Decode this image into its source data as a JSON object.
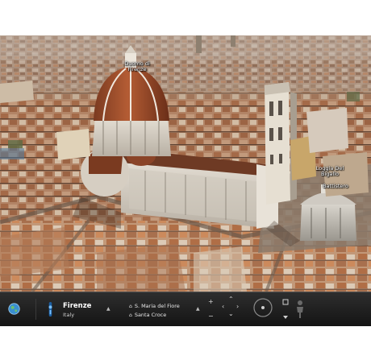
{
  "map": {
    "labels": [
      {
        "line1": "Duomo di",
        "line2": "Firenze"
      },
      {
        "line1": "Loggia Del",
        "line2": "Bigallo"
      },
      {
        "line1": "Battistero",
        "line2": ""
      }
    ]
  },
  "toolbar": {
    "location": {
      "city": "Firenze",
      "country": "Italy"
    },
    "poi_items": [
      {
        "label": "S. Maria del Fiore",
        "icon": "landmark-icon"
      },
      {
        "label": "Santa Croce",
        "icon": "landmark-icon"
      }
    ],
    "icons": {
      "globe": "globe-icon",
      "pin": "location-pin-icon",
      "person": "street-view-person-icon"
    },
    "colors": {
      "bar": "#1e1e1e",
      "text": "#e8e8e8"
    }
  }
}
